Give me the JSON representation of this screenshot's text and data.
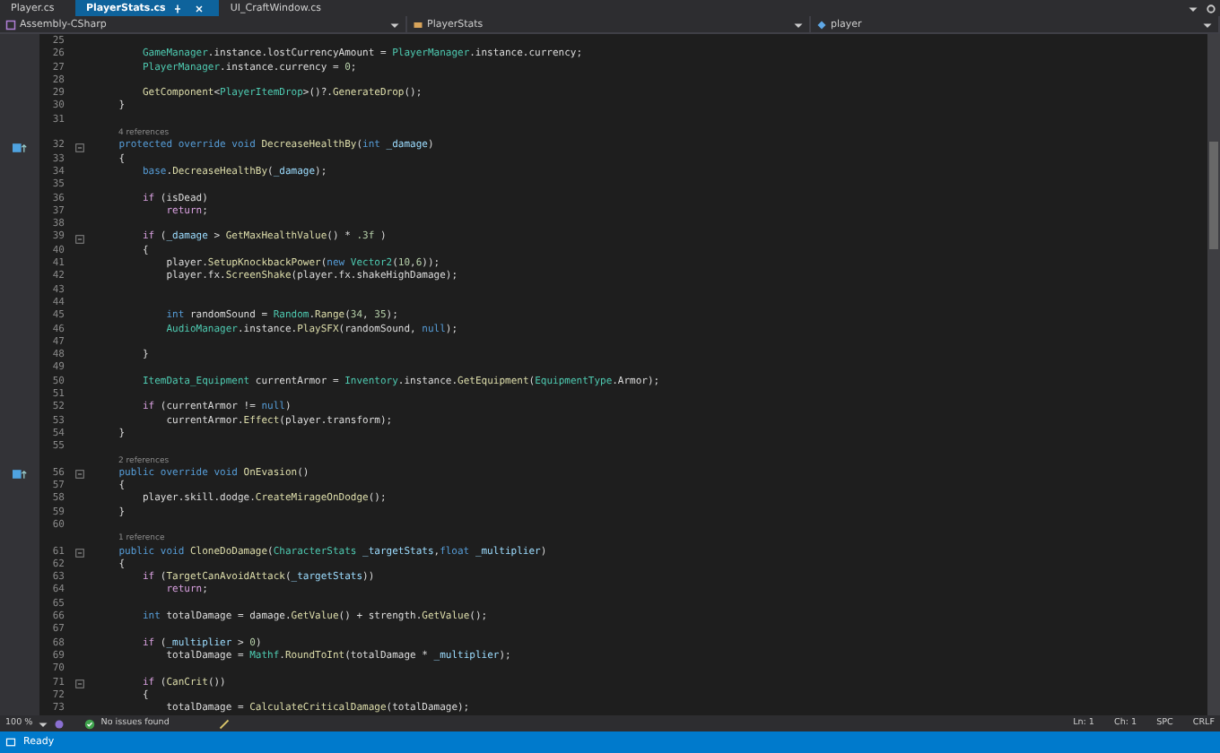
{
  "tabs": [
    {
      "label": "Player.cs",
      "selected": false
    },
    {
      "label": "PlayerStats.cs",
      "selected": true
    },
    {
      "label": "UI_CraftWindow.cs",
      "selected": false
    }
  ],
  "navigation": {
    "project": "Assembly-CSharp",
    "class": "PlayerStats",
    "member": "player"
  },
  "lines": [
    {
      "kind": "code",
      "number": "25",
      "override": false,
      "fold": false
    },
    {
      "kind": "code",
      "number": "26",
      "override": false,
      "fold": false,
      "tokens": [
        {
          "kind": "type",
          "text": "        GameManager"
        },
        {
          "kind": "plain",
          "text": ".instance.lostCurrencyAmount = "
        },
        {
          "kind": "type",
          "text": "PlayerManager"
        },
        {
          "kind": "plain",
          "text": ".instance.currency;"
        }
      ]
    },
    {
      "kind": "code",
      "number": "27",
      "override": false,
      "fold": false,
      "tokens": [
        {
          "kind": "type",
          "text": "        PlayerManager"
        },
        {
          "kind": "plain",
          "text": ".instance.currency = "
        },
        {
          "kind": "number",
          "text": "0"
        },
        {
          "kind": "plain",
          "text": ";"
        }
      ]
    },
    {
      "kind": "code",
      "number": "28",
      "override": false,
      "fold": false
    },
    {
      "kind": "code",
      "number": "29",
      "override": false,
      "fold": false,
      "tokens": [
        {
          "kind": "method",
          "text": "        GetComponent"
        },
        {
          "kind": "plain",
          "text": "<"
        },
        {
          "kind": "type",
          "text": "PlayerItemDrop"
        },
        {
          "kind": "plain",
          "text": ">()?."
        },
        {
          "kind": "method",
          "text": "GenerateDrop"
        },
        {
          "kind": "plain",
          "text": "();"
        }
      ]
    },
    {
      "kind": "code",
      "number": "30",
      "override": false,
      "fold": false,
      "tokens": [
        {
          "kind": "plain",
          "text": "    }"
        }
      ]
    },
    {
      "kind": "code",
      "number": "31",
      "override": false,
      "fold": false
    },
    {
      "kind": "lens",
      "text": "4 references"
    },
    {
      "kind": "code",
      "number": "32",
      "override": true,
      "fold": true,
      "tokens": [
        {
          "kind": "keyword",
          "text": "    protected override void "
        },
        {
          "kind": "method",
          "text": "DecreaseHealthBy"
        },
        {
          "kind": "plain",
          "text": "("
        },
        {
          "kind": "keyword",
          "text": "int "
        },
        {
          "kind": "param",
          "text": "_damage"
        },
        {
          "kind": "plain",
          "text": ")"
        }
      ]
    },
    {
      "kind": "code",
      "number": "33",
      "override": false,
      "fold": false,
      "tokens": [
        {
          "kind": "plain",
          "text": "    {"
        }
      ]
    },
    {
      "kind": "code",
      "number": "34",
      "override": false,
      "fold": false,
      "tokens": [
        {
          "kind": "keyword",
          "text": "        base"
        },
        {
          "kind": "plain",
          "text": "."
        },
        {
          "kind": "method",
          "text": "DecreaseHealthBy"
        },
        {
          "kind": "plain",
          "text": "("
        },
        {
          "kind": "param",
          "text": "_damage"
        },
        {
          "kind": "plain",
          "text": ");"
        }
      ]
    },
    {
      "kind": "code",
      "number": "35",
      "override": false,
      "fold": false
    },
    {
      "kind": "code",
      "number": "36",
      "override": false,
      "fold": false,
      "tokens": [
        {
          "kind": "control",
          "text": "        if"
        },
        {
          "kind": "plain",
          "text": " (isDead)"
        }
      ]
    },
    {
      "kind": "code",
      "number": "37",
      "override": false,
      "fold": false,
      "tokens": [
        {
          "kind": "control",
          "text": "            return"
        },
        {
          "kind": "plain",
          "text": ";"
        }
      ]
    },
    {
      "kind": "code",
      "number": "38",
      "override": false,
      "fold": false
    },
    {
      "kind": "code",
      "number": "39",
      "override": false,
      "fold": true,
      "tokens": [
        {
          "kind": "control",
          "text": "        if"
        },
        {
          "kind": "plain",
          "text": " ("
        },
        {
          "kind": "param",
          "text": "_damage"
        },
        {
          "kind": "plain",
          "text": " > "
        },
        {
          "kind": "method",
          "text": "GetMaxHealthValue"
        },
        {
          "kind": "plain",
          "text": "() * "
        },
        {
          "kind": "number",
          "text": ".3f"
        },
        {
          "kind": "plain",
          "text": " )"
        }
      ]
    },
    {
      "kind": "code",
      "number": "40",
      "override": false,
      "fold": false,
      "tokens": [
        {
          "kind": "plain",
          "text": "        {"
        }
      ]
    },
    {
      "kind": "code",
      "number": "41",
      "override": false,
      "fold": false,
      "tokens": [
        {
          "kind": "plain",
          "text": "            player."
        },
        {
          "kind": "method",
          "text": "SetupKnockbackPower"
        },
        {
          "kind": "plain",
          "text": "("
        },
        {
          "kind": "keyword",
          "text": "new "
        },
        {
          "kind": "type",
          "text": "Vector2"
        },
        {
          "kind": "plain",
          "text": "("
        },
        {
          "kind": "number",
          "text": "10"
        },
        {
          "kind": "plain",
          "text": ","
        },
        {
          "kind": "number",
          "text": "6"
        },
        {
          "kind": "plain",
          "text": "));"
        }
      ]
    },
    {
      "kind": "code",
      "number": "42",
      "override": false,
      "fold": false,
      "tokens": [
        {
          "kind": "plain",
          "text": "            player.fx."
        },
        {
          "kind": "method",
          "text": "ScreenShake"
        },
        {
          "kind": "plain",
          "text": "(player.fx.shakeHighDamage);"
        }
      ]
    },
    {
      "kind": "code",
      "number": "43",
      "override": false,
      "fold": false
    },
    {
      "kind": "code",
      "number": "44",
      "override": false,
      "fold": false
    },
    {
      "kind": "code",
      "number": "45",
      "override": false,
      "fold": false,
      "tokens": [
        {
          "kind": "keyword",
          "text": "            int "
        },
        {
          "kind": "plain",
          "text": "randomSound = "
        },
        {
          "kind": "type",
          "text": "Random"
        },
        {
          "kind": "plain",
          "text": "."
        },
        {
          "kind": "method",
          "text": "Range"
        },
        {
          "kind": "plain",
          "text": "("
        },
        {
          "kind": "number",
          "text": "34"
        },
        {
          "kind": "plain",
          "text": ", "
        },
        {
          "kind": "number",
          "text": "35"
        },
        {
          "kind": "plain",
          "text": ");"
        }
      ]
    },
    {
      "kind": "code",
      "number": "46",
      "override": false,
      "fold": false,
      "tokens": [
        {
          "kind": "type",
          "text": "            AudioManager"
        },
        {
          "kind": "plain",
          "text": ".instance."
        },
        {
          "kind": "method",
          "text": "PlaySFX"
        },
        {
          "kind": "plain",
          "text": "(randomSound, "
        },
        {
          "kind": "keyword",
          "text": "null"
        },
        {
          "kind": "plain",
          "text": ");"
        }
      ]
    },
    {
      "kind": "code",
      "number": "47",
      "override": false,
      "fold": false
    },
    {
      "kind": "code",
      "number": "48",
      "override": false,
      "fold": false,
      "tokens": [
        {
          "kind": "plain",
          "text": "        }"
        }
      ]
    },
    {
      "kind": "code",
      "number": "49",
      "override": false,
      "fold": false
    },
    {
      "kind": "code",
      "number": "50",
      "override": false,
      "fold": false,
      "tokens": [
        {
          "kind": "type",
          "text": "        ItemData_Equipment"
        },
        {
          "kind": "plain",
          "text": " currentArmor = "
        },
        {
          "kind": "type",
          "text": "Inventory"
        },
        {
          "kind": "plain",
          "text": ".instance."
        },
        {
          "kind": "method",
          "text": "GetEquipment"
        },
        {
          "kind": "plain",
          "text": "("
        },
        {
          "kind": "type",
          "text": "EquipmentType"
        },
        {
          "kind": "plain",
          "text": ".Armor);"
        }
      ]
    },
    {
      "kind": "code",
      "number": "51",
      "override": false,
      "fold": false
    },
    {
      "kind": "code",
      "number": "52",
      "override": false,
      "fold": false,
      "tokens": [
        {
          "kind": "control",
          "text": "        if"
        },
        {
          "kind": "plain",
          "text": " (currentArmor != "
        },
        {
          "kind": "keyword",
          "text": "null"
        },
        {
          "kind": "plain",
          "text": ")"
        }
      ]
    },
    {
      "kind": "code",
      "number": "53",
      "override": false,
      "fold": false,
      "tokens": [
        {
          "kind": "plain",
          "text": "            currentArmor."
        },
        {
          "kind": "method",
          "text": "Effect"
        },
        {
          "kind": "plain",
          "text": "(player.transform);"
        }
      ]
    },
    {
      "kind": "code",
      "number": "54",
      "override": false,
      "fold": false,
      "tokens": [
        {
          "kind": "plain",
          "text": "    }"
        }
      ]
    },
    {
      "kind": "code",
      "number": "55",
      "override": false,
      "fold": false
    },
    {
      "kind": "lens",
      "text": "2 references"
    },
    {
      "kind": "code",
      "number": "56",
      "override": true,
      "fold": true,
      "tokens": [
        {
          "kind": "keyword",
          "text": "    public override void "
        },
        {
          "kind": "method",
          "text": "OnEvasion"
        },
        {
          "kind": "plain",
          "text": "()"
        }
      ]
    },
    {
      "kind": "code",
      "number": "57",
      "override": false,
      "fold": false,
      "tokens": [
        {
          "kind": "plain",
          "text": "    {"
        }
      ]
    },
    {
      "kind": "code",
      "number": "58",
      "override": false,
      "fold": false,
      "tokens": [
        {
          "kind": "plain",
          "text": "        player.skill.dodge."
        },
        {
          "kind": "method",
          "text": "CreateMirageOnDodge"
        },
        {
          "kind": "plain",
          "text": "();"
        }
      ]
    },
    {
      "kind": "code",
      "number": "59",
      "override": false,
      "fold": false,
      "tokens": [
        {
          "kind": "plain",
          "text": "    }"
        }
      ]
    },
    {
      "kind": "code",
      "number": "60",
      "override": false,
      "fold": false
    },
    {
      "kind": "lens",
      "text": "1 reference"
    },
    {
      "kind": "code",
      "number": "61",
      "override": false,
      "fold": true,
      "tokens": [
        {
          "kind": "keyword",
          "text": "    public void "
        },
        {
          "kind": "method",
          "text": "CloneDoDamage"
        },
        {
          "kind": "plain",
          "text": "("
        },
        {
          "kind": "type",
          "text": "CharacterStats"
        },
        {
          "kind": "param",
          "text": " _targetStats"
        },
        {
          "kind": "plain",
          "text": ","
        },
        {
          "kind": "keyword",
          "text": "float "
        },
        {
          "kind": "param",
          "text": "_multiplier"
        },
        {
          "kind": "plain",
          "text": ")"
        }
      ]
    },
    {
      "kind": "code",
      "number": "62",
      "override": false,
      "fold": false,
      "tokens": [
        {
          "kind": "plain",
          "text": "    {"
        }
      ]
    },
    {
      "kind": "code",
      "number": "63",
      "override": false,
      "fold": false,
      "tokens": [
        {
          "kind": "control",
          "text": "        if"
        },
        {
          "kind": "plain",
          "text": " ("
        },
        {
          "kind": "method",
          "text": "TargetCanAvoidAttack"
        },
        {
          "kind": "plain",
          "text": "("
        },
        {
          "kind": "param",
          "text": "_targetStats"
        },
        {
          "kind": "plain",
          "text": "))"
        }
      ]
    },
    {
      "kind": "code",
      "number": "64",
      "override": false,
      "fold": false,
      "tokens": [
        {
          "kind": "control",
          "text": "            return"
        },
        {
          "kind": "plain",
          "text": ";"
        }
      ]
    },
    {
      "kind": "code",
      "number": "65",
      "override": false,
      "fold": false
    },
    {
      "kind": "code",
      "number": "66",
      "override": false,
      "fold": false,
      "tokens": [
        {
          "kind": "keyword",
          "text": "        int "
        },
        {
          "kind": "plain",
          "text": "totalDamage = damage."
        },
        {
          "kind": "method",
          "text": "GetValue"
        },
        {
          "kind": "plain",
          "text": "() + strength."
        },
        {
          "kind": "method",
          "text": "GetValue"
        },
        {
          "kind": "plain",
          "text": "();"
        }
      ]
    },
    {
      "kind": "code",
      "number": "67",
      "override": false,
      "fold": false
    },
    {
      "kind": "code",
      "number": "68",
      "override": false,
      "fold": false,
      "tokens": [
        {
          "kind": "control",
          "text": "        if"
        },
        {
          "kind": "plain",
          "text": " ("
        },
        {
          "kind": "param",
          "text": "_multiplier"
        },
        {
          "kind": "plain",
          "text": " > "
        },
        {
          "kind": "number",
          "text": "0"
        },
        {
          "kind": "plain",
          "text": ")"
        }
      ]
    },
    {
      "kind": "code",
      "number": "69",
      "override": false,
      "fold": false,
      "tokens": [
        {
          "kind": "plain",
          "text": "            totalDamage = "
        },
        {
          "kind": "type",
          "text": "Mathf"
        },
        {
          "kind": "plain",
          "text": "."
        },
        {
          "kind": "method",
          "text": "RoundToInt"
        },
        {
          "kind": "plain",
          "text": "(totalDamage * "
        },
        {
          "kind": "param",
          "text": "_multiplier"
        },
        {
          "kind": "plain",
          "text": ");"
        }
      ]
    },
    {
      "kind": "code",
      "number": "70",
      "override": false,
      "fold": false
    },
    {
      "kind": "code",
      "number": "71",
      "override": false,
      "fold": true,
      "tokens": [
        {
          "kind": "control",
          "text": "        if"
        },
        {
          "kind": "plain",
          "text": " ("
        },
        {
          "kind": "method",
          "text": "CanCrit"
        },
        {
          "kind": "plain",
          "text": "())"
        }
      ]
    },
    {
      "kind": "code",
      "number": "72",
      "override": false,
      "fold": false,
      "tokens": [
        {
          "kind": "plain",
          "text": "        {"
        }
      ]
    },
    {
      "kind": "code",
      "number": "73",
      "override": false,
      "fold": false,
      "tokens": [
        {
          "kind": "plain",
          "text": "            totalDamage = "
        },
        {
          "kind": "method",
          "text": "CalculateCriticalDamage"
        },
        {
          "kind": "plain",
          "text": "(totalDamage);"
        }
      ]
    }
  ],
  "info_bar": {
    "zoom": "100 %",
    "issues": "No issues found",
    "line": "Ln: 1",
    "column": "Ch: 1",
    "whitespace": "SPC",
    "line_ending": "CRLF"
  },
  "status_bar": {
    "text": "Ready"
  }
}
